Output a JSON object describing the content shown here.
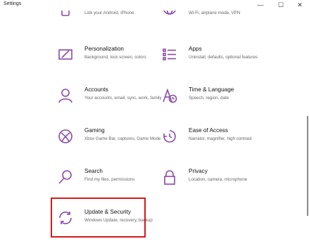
{
  "window": {
    "title": "Settings",
    "minimize_glyph": "—",
    "maximize_glyph": "☐",
    "close_glyph": "✕"
  },
  "tiles": [
    {
      "title": "",
      "desc": "Link your Android, iPhone",
      "icon": "phone-icon"
    },
    {
      "title": "",
      "desc": "Wi-Fi, airplane mode, VPN",
      "icon": "globe-icon"
    },
    {
      "title": "Personalization",
      "desc": "Background, lock screen, colors",
      "icon": "personalization-icon"
    },
    {
      "title": "Apps",
      "desc": "Uninstall, defaults, optional features",
      "icon": "apps-icon"
    },
    {
      "title": "Accounts",
      "desc": "Your accounts, email, sync, work, family",
      "icon": "person-icon"
    },
    {
      "title": "Time & Language",
      "desc": "Speech, region, date",
      "icon": "time-language-icon"
    },
    {
      "title": "Gaming",
      "desc": "Xbox Game Bar, captures, Game Mode",
      "icon": "xbox-icon"
    },
    {
      "title": "Ease of Access",
      "desc": "Narrator, magnifier, high contrast",
      "icon": "ease-of-access-icon"
    },
    {
      "title": "Search",
      "desc": "Find my files, permissions",
      "icon": "search-icon"
    },
    {
      "title": "Privacy",
      "desc": "Location, camera, microphone",
      "icon": "lock-icon"
    },
    {
      "title": "Update & Security",
      "desc": "Windows Update, recovery, backup",
      "icon": "update-icon"
    }
  ],
  "colors": {
    "accent": "#8a4aa8",
    "highlight_border": "#d71a1a"
  }
}
